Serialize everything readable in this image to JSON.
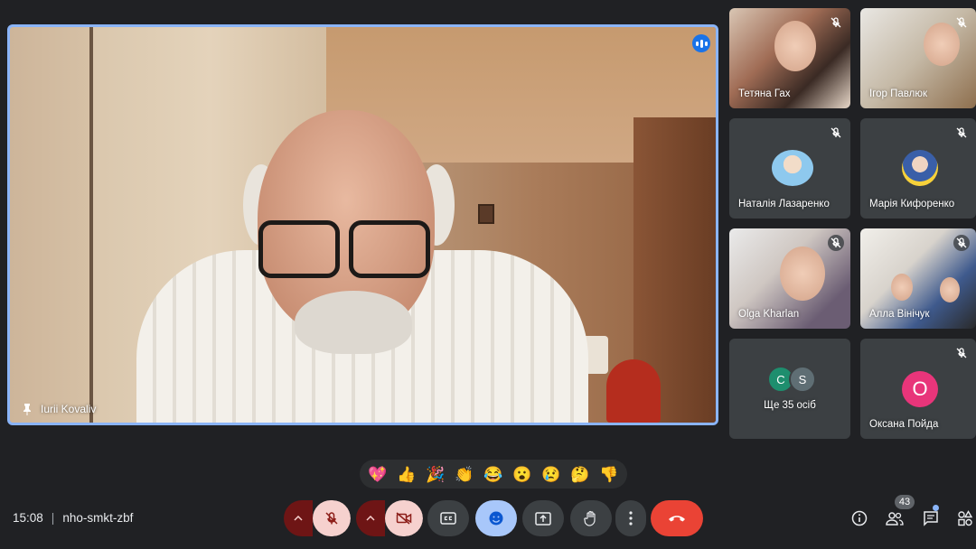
{
  "main_speaker": {
    "name": "Iurii Kovaliv"
  },
  "participants": [
    {
      "name": "Тетяна Гах"
    },
    {
      "name": "Ігор Павлюк"
    },
    {
      "name": "Наталія Лазаренко"
    },
    {
      "name": "Марія Кифоренко"
    },
    {
      "name": "Olga Kharlan"
    },
    {
      "name": "Алла Вінічук"
    },
    {
      "name": "Ще 35 осіб",
      "initials": [
        "C",
        "S"
      ]
    },
    {
      "name": "Оксана Пойда",
      "initial": "О"
    }
  ],
  "reactions": [
    "💖",
    "👍",
    "🎉",
    "👏",
    "😂",
    "😮",
    "😢",
    "🤔",
    "👎"
  ],
  "meeting": {
    "time": "15:08",
    "code": "nho-smkt-zbf"
  },
  "people_count": "43",
  "colors": {
    "accent": "#8ab4f8",
    "end_call": "#ea4335",
    "muted_bg": "#f6d1ce",
    "avatar_pink": "#e8357a"
  },
  "icons": [
    "pin-icon",
    "speaking-icon",
    "mic-off-icon",
    "camera-off-icon",
    "captions-icon",
    "emoji-icon",
    "present-icon",
    "raise-hand-icon",
    "more-options-icon",
    "end-call-icon",
    "info-icon",
    "people-icon",
    "chat-icon",
    "activities-icon",
    "chevron-up-icon"
  ]
}
